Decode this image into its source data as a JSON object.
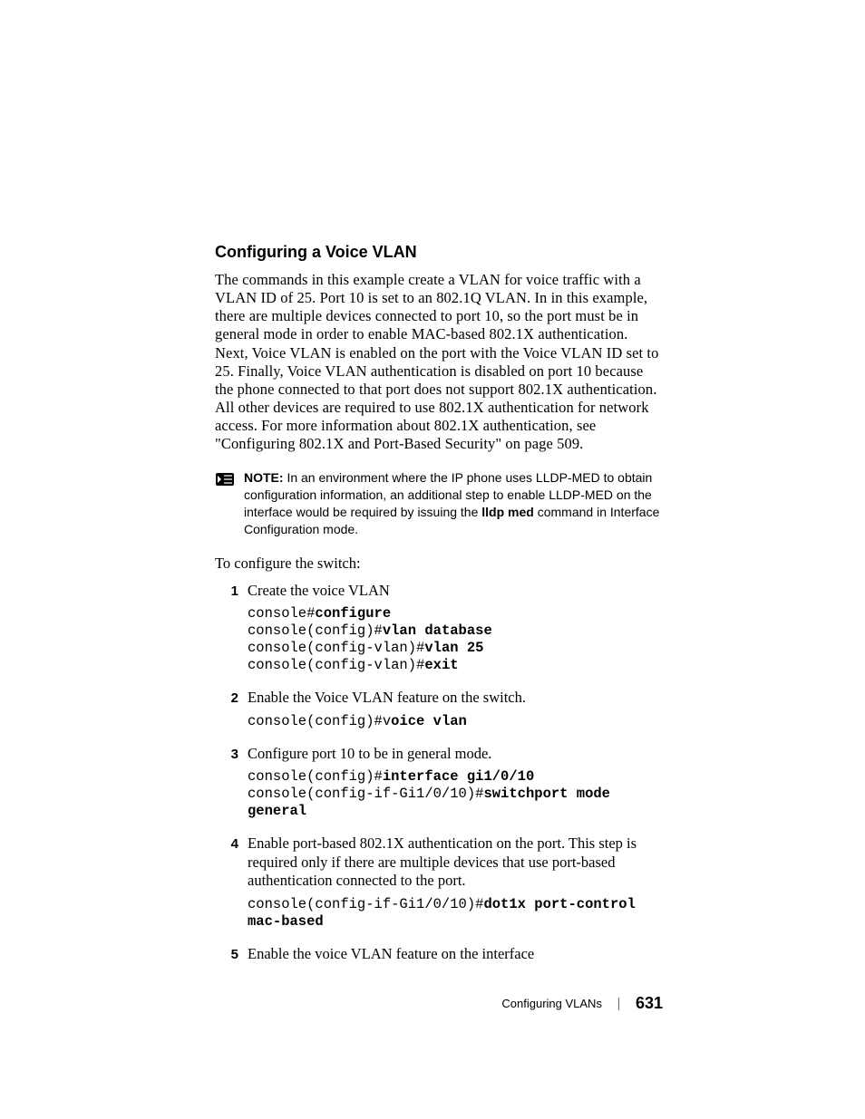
{
  "heading": "Configuring a Voice VLAN",
  "body_para": "The commands in this example create a VLAN for voice traffic with a VLAN ID of 25. Port 10 is set to an 802.1Q VLAN. In in this example, there are multiple devices connected to port 10, so the port must be in general mode in order to enable MAC-based 802.1X authentication. Next, Voice VLAN is enabled on the port with the Voice VLAN ID set to 25. Finally, Voice VLAN authentication is disabled on port 10 because the phone connected to that port does not support 802.1X authentication. All other devices are required to use 802.1X authentication for network access. For more information about 802.1X authentication, see \"Configuring 802.1X and Port-Based Security\" on page 509.",
  "note": {
    "label": "NOTE:",
    "text_before_cmd": " In an environment where the IP phone uses LLDP-MED to obtain configuration information, an additional step to enable LLDP-MED on the interface would be required by issuing the ",
    "inline_cmd": "lldp med",
    "text_after_cmd": " command in Interface Configuration mode."
  },
  "lead_in": "To configure the switch:",
  "steps": [
    {
      "num": "1",
      "desc": "Create the voice VLAN",
      "cmd": [
        {
          "pre": "console#",
          "bold": "configure",
          "post": ""
        },
        {
          "pre": "console(config)#",
          "bold": "vlan database",
          "post": ""
        },
        {
          "pre": "console(config-vlan)#",
          "bold": "vlan 25",
          "post": ""
        },
        {
          "pre": "console(config-vlan)#",
          "bold": "exit",
          "post": ""
        }
      ]
    },
    {
      "num": "2",
      "desc": "Enable the Voice VLAN feature on the switch.",
      "cmd": [
        {
          "pre": "console(config)#v",
          "bold": "oice vlan",
          "post": ""
        }
      ]
    },
    {
      "num": "3",
      "desc": "Configure port 10 to be in general mode.",
      "cmd": [
        {
          "pre": "console(config)#",
          "bold": "interface gi1/0/10",
          "post": ""
        },
        {
          "pre": "console(config-if-Gi1/0/10)#",
          "bold": "switchport mode general",
          "post": ""
        }
      ]
    },
    {
      "num": "4",
      "desc": "Enable port-based 802.1X authentication on the port. This step is required only if there are multiple devices that use port-based authentication connected to the port.",
      "cmd": [
        {
          "pre": "console(config-if-Gi1/0/10)#",
          "bold": "dot1x port-control mac-based",
          "post": ""
        }
      ]
    },
    {
      "num": "5",
      "desc": "Enable the voice VLAN feature on the interface",
      "cmd": []
    }
  ],
  "footer": {
    "section": "Configuring VLANs",
    "page": "631"
  }
}
